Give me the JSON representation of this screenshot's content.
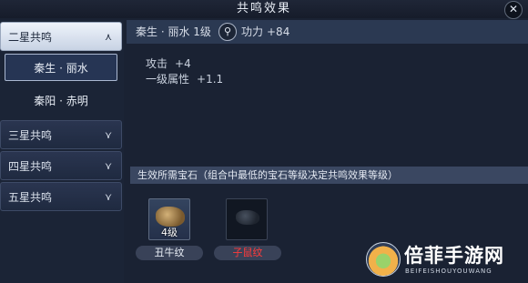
{
  "window": {
    "title": "共鸣效果",
    "close_symbol": "✕"
  },
  "sidebar": {
    "sections": [
      {
        "label": "二星共鸣",
        "expanded": true,
        "items": [
          {
            "label": "秦生 · 丽水",
            "selected": true
          },
          {
            "label": "秦阳 · 赤明",
            "selected": false
          }
        ]
      },
      {
        "label": "三星共鸣",
        "expanded": false
      },
      {
        "label": "四星共鸣",
        "expanded": false
      },
      {
        "label": "五星共鸣",
        "expanded": false
      }
    ],
    "icons": {
      "expanded": "chevron-up-icon",
      "collapsed": "chevron-down-icon"
    }
  },
  "detail": {
    "name_level": "秦生 · 丽水 1级",
    "search_icon": "search-icon",
    "power_label": "功力",
    "power_value": "+84",
    "stats": [
      {
        "label": "攻击",
        "value": "+4"
      },
      {
        "label": "一级属性",
        "value": "+1.1"
      }
    ],
    "gem_requirement_text": "生效所需宝石（组合中最低的宝石等级决定共鸣效果等级）",
    "gems": [
      {
        "level": "4级",
        "name": "丑牛纹",
        "name_color": "#e8edf5"
      },
      {
        "level": "",
        "name": "子鼠纹",
        "name_color": "#ff3b3b"
      }
    ]
  },
  "watermark": {
    "title": "倍菲手游网",
    "subtitle": "BEIFEISHOUYOUWANG"
  },
  "colors": {
    "background": "#1a2233",
    "header_bar": "#2b3952",
    "warning_red": "#ff3b3b"
  }
}
